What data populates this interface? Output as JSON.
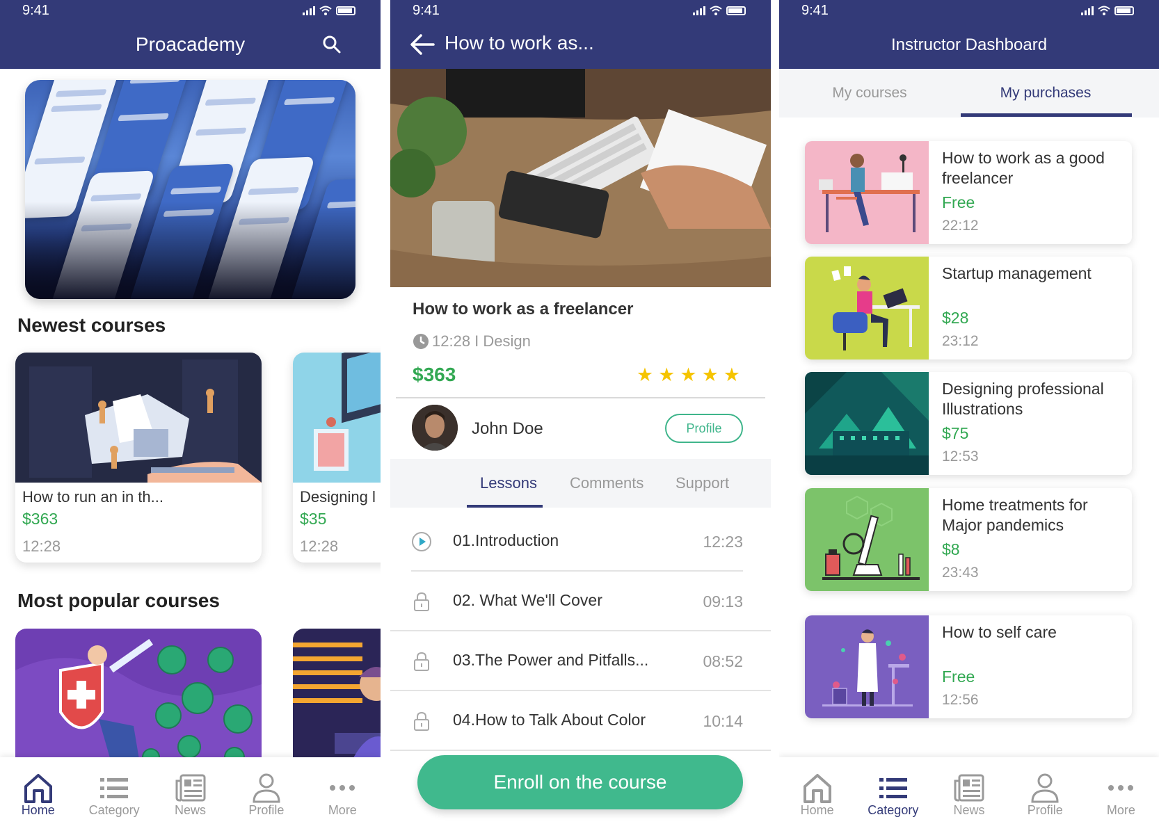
{
  "status": {
    "time": "9:41"
  },
  "home": {
    "title": "Proacademy",
    "newest_title": "Newest courses",
    "popular_title": "Most popular courses",
    "newest": [
      {
        "title": "How to run an in th...",
        "price": "$363",
        "time": "12:28"
      },
      {
        "title": "Designing l",
        "price": "$35",
        "time": "12:28"
      }
    ]
  },
  "detail": {
    "nav_title": "How to work as...",
    "course_title": "How to work as a freelancer",
    "meta": "12:28 I Design",
    "price": "$363",
    "rating": 5,
    "instructor": "John Doe",
    "profile_label": "Profile",
    "tabs": [
      "Lessons",
      "Comments",
      "Support"
    ],
    "lessons": [
      {
        "name": "01.Introduction",
        "time": "12:23"
      },
      {
        "name": "02. What We'll Cover",
        "time": "09:13"
      },
      {
        "name": "03.The Power and Pitfalls...",
        "time": "08:52"
      },
      {
        "name": "04.How to Talk About Color",
        "time": "10:14"
      }
    ],
    "enroll_label": "Enroll on the course"
  },
  "dashboard": {
    "title": "Instructor Dashboard",
    "tabs": [
      "My courses",
      "My purchases"
    ],
    "purchases": [
      {
        "title": "How to work as a good freelancer",
        "price": "Free",
        "time": "22:12"
      },
      {
        "title": "Startup management",
        "price": "$28",
        "time": "23:12"
      },
      {
        "title": "Designing professional Illustrations",
        "price": "$75",
        "time": "12:53"
      },
      {
        "title": "Home treatments for Major pandemics",
        "price": "$8",
        "time": "23:43"
      },
      {
        "title": "How to self care",
        "price": "Free",
        "time": "12:56"
      }
    ]
  },
  "tabbar": {
    "items": [
      "Home",
      "Category",
      "News",
      "Profile",
      "More"
    ]
  },
  "colors": {
    "primary": "#333a78",
    "accent_green": "#32a852",
    "button_green": "#40b98d",
    "star": "#f5c400"
  }
}
